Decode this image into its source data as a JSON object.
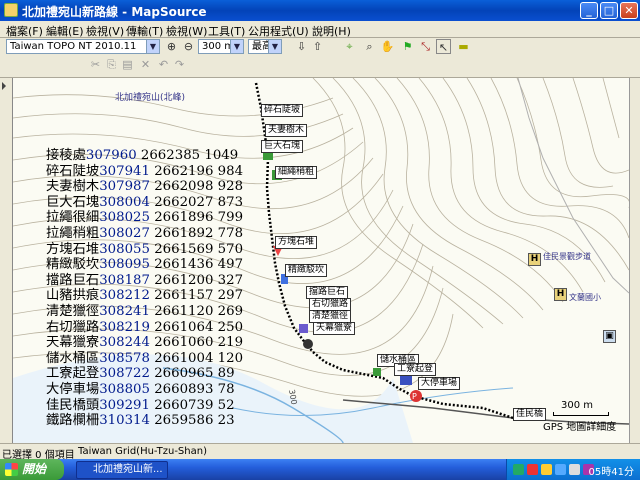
{
  "window": {
    "title": "北加禮宛山新路線 - MapSource",
    "buttons": {
      "minimize": "_",
      "maximize": "□",
      "close": "✕"
    }
  },
  "menu": [
    "檔案(F)",
    "編輯(E)",
    "檢視(V)",
    "傳輸(T)",
    "檢視(W)",
    "工具(T)",
    "公用程式(U)",
    "說明(H)"
  ],
  "toolbar": {
    "map_product": "Taiwan TOPO NT 2010.11",
    "zoom": "300 m",
    "detail": "最高"
  },
  "data_table": [
    {
      "name": "接稜處",
      "x": "307960",
      "y": "2662385",
      "alt": "1049"
    },
    {
      "name": "碎石陡坡",
      "x": "307941",
      "y": "2662196",
      "alt": "984"
    },
    {
      "name": "夫妻樹木",
      "x": "307987",
      "y": "2662098",
      "alt": "928"
    },
    {
      "name": "巨大石塊",
      "x": "308004",
      "y": "2662027",
      "alt": "873"
    },
    {
      "name": "拉繩很細",
      "x": "308025",
      "y": "2661896",
      "alt": "799"
    },
    {
      "name": "拉繩稍粗",
      "x": "308027",
      "y": "2661892",
      "alt": "778"
    },
    {
      "name": "方塊石堆",
      "x": "308055",
      "y": "2661569",
      "alt": "570"
    },
    {
      "name": "精緻駁坎",
      "x": "308095",
      "y": "2661436",
      "alt": "497"
    },
    {
      "name": "擋路巨石",
      "x": "308187",
      "y": "2661200",
      "alt": "327"
    },
    {
      "name": "山豬拱痕",
      "x": "308212",
      "y": "2661157",
      "alt": "297"
    },
    {
      "name": "清楚獵徑",
      "x": "308241",
      "y": "2661120",
      "alt": "269"
    },
    {
      "name": "右切獵路",
      "x": "308219",
      "y": "2661064",
      "alt": "250"
    },
    {
      "name": "天幕獵寮",
      "x": "308244",
      "y": "2661060",
      "alt": "219"
    },
    {
      "name": "儲水桶區",
      "x": "308578",
      "y": "2661004",
      "alt": "120"
    },
    {
      "name": "工寮起登",
      "x": "308722",
      "y": "2660965",
      "alt": "89"
    },
    {
      "name": "大停車場",
      "x": "308805",
      "y": "2660893",
      "alt": "78"
    },
    {
      "name": "佳民橋頭",
      "x": "309291",
      "y": "2660739",
      "alt": "52"
    },
    {
      "name": "鐵路欄柵",
      "x": "310314",
      "y": "2659586",
      "alt": "23"
    }
  ],
  "map": {
    "top_label": "北加禮宛山(北峰)",
    "waypoints": [
      "碎石陡坡",
      "夫妻樹木",
      "巨大石塊",
      "細繩稍粗",
      "方塊石堆",
      "精緻駁坎",
      "擋路巨石",
      "右切獵路",
      "清楚獵徑",
      "天幕獵寮",
      "儲水桶區",
      "工寮起登",
      "大停車場",
      "佳民橋"
    ],
    "poi_label1": "佳民景觀步道",
    "poi_label2": "文蘭國小",
    "scale": "300 m",
    "detail_note": "GPS 地圖詳細度",
    "contour_label": "300"
  },
  "status": {
    "selection": "已選擇 0 個項目",
    "grid": "Taiwan Grid(Hu-Tzu-Shan)"
  },
  "taskbar": {
    "start": "開始",
    "task": "北加禮宛山新...",
    "clock": "05時41分"
  }
}
